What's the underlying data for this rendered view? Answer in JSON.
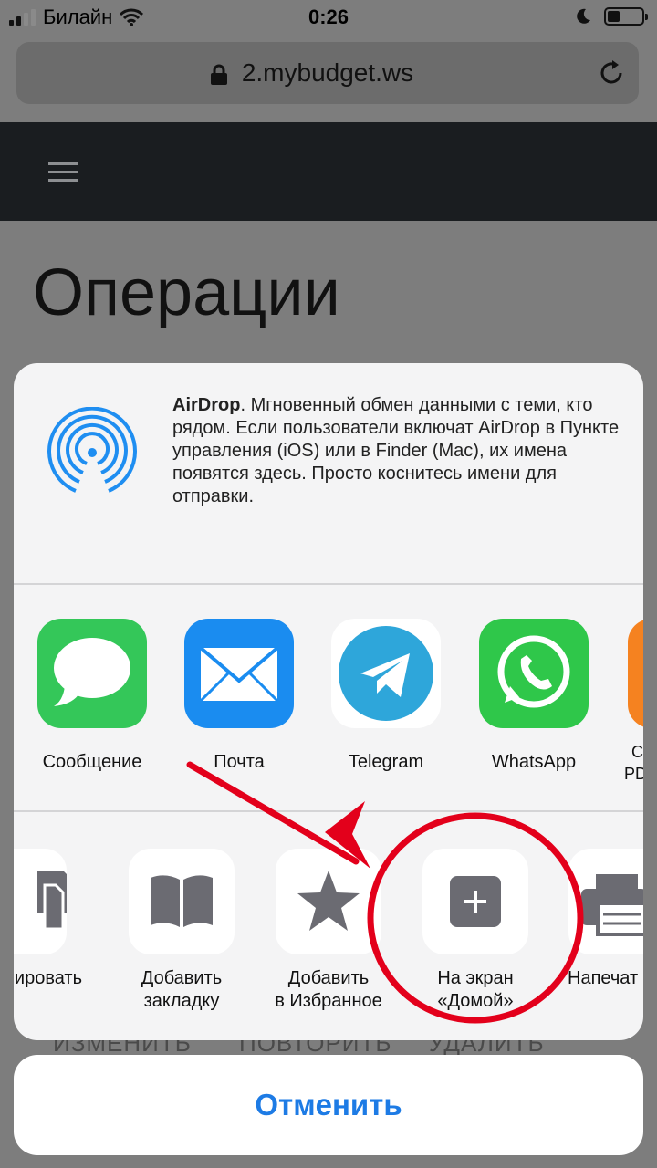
{
  "status_bar": {
    "carrier": "Билайн",
    "time": "0:26",
    "battery_fraction": 0.35
  },
  "browser": {
    "url": "2.mybudget.ws"
  },
  "site": {
    "page_title": "Операции",
    "bg_actions": [
      "ИЗМЕНИТЬ",
      "ПОВТОРИТЬ",
      "УДАЛИТЬ"
    ]
  },
  "share_sheet": {
    "airdrop_title": "AirDrop",
    "airdrop_text": ". Мгновенный обмен данными с теми, кто рядом. Если пользователи включат AirDrop в Пункте управления (iOS) или в Finder (Mac), их имена появятся здесь. Просто коснитесь имени для отправки.",
    "apps": [
      {
        "label": "Сообщение",
        "icon": "messages-icon",
        "color": "#34c759"
      },
      {
        "label": "Почта",
        "icon": "mail-icon",
        "color": "#1a8cf0"
      },
      {
        "label": "Telegram",
        "icon": "telegram-icon",
        "color": "#2ea6da"
      },
      {
        "label": "WhatsApp",
        "icon": "whatsapp-icon",
        "color": "#2fc74a"
      },
      {
        "label_line1": "С",
        "label_line2": "PD",
        "icon": "pdf-app-icon",
        "color": "#f58220"
      }
    ],
    "actions": [
      {
        "label": "пировать",
        "icon": "copy-icon"
      },
      {
        "label_line1": "Добавить",
        "label_line2": "закладку",
        "icon": "bookmark-icon"
      },
      {
        "label_line1": "Добавить",
        "label_line2": "в Избранное",
        "icon": "star-icon"
      },
      {
        "label_line1": "На экран",
        "label_line2": "«Домой»",
        "icon": "add-home-icon"
      },
      {
        "label": "Напечат",
        "icon": "print-icon"
      }
    ],
    "cancel_label": "Отменить"
  },
  "colors": {
    "accent": "#1d7be5",
    "annotation": "#e3001b",
    "glyph": "#6b6b72"
  }
}
